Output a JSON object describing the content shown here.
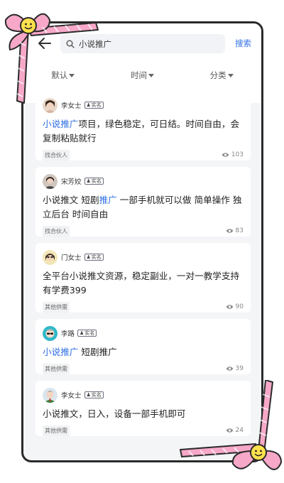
{
  "search": {
    "value": "小说推广",
    "button_label": "搜索"
  },
  "filters": [
    {
      "label": "默认"
    },
    {
      "label": "时间"
    },
    {
      "label": "分类"
    }
  ],
  "verify_label": "实名",
  "posts": [
    {
      "user": "李女士",
      "content": [
        {
          "text": "小说推广",
          "hl": true
        },
        {
          "text": "项目，绿色稳定，可日结。时间自由，会复制粘贴就行",
          "hl": false
        }
      ],
      "tag": "找合伙人",
      "views": "103"
    },
    {
      "user": "宋芳姣",
      "content": [
        {
          "text": "小说推文 短剧",
          "hl": false
        },
        {
          "text": "推广",
          "hl": true
        },
        {
          "text": " 一部手机就可以做 简单操作 独立后台 时间自由",
          "hl": false
        }
      ],
      "tag": "找合伙人",
      "views": "83"
    },
    {
      "user": "门女士",
      "content": [
        {
          "text": "全平台小说推文资源，稳定副业，一对一教学支持 有学费399",
          "hl": false
        }
      ],
      "tag": "其他供需",
      "views": "90"
    },
    {
      "user": "李路",
      "content": [
        {
          "text": "小说推广",
          "hl": true
        },
        {
          "text": " 短剧推广",
          "hl": false
        }
      ],
      "tag": "其他供需",
      "views": "39"
    },
    {
      "user": "李女士",
      "content": [
        {
          "text": "小说推文，日入，设备一部手机即可",
          "hl": false
        }
      ],
      "tag": "其他供需",
      "views": "24"
    }
  ],
  "colors": {
    "accent": "#2f6fe4",
    "ribbon_pink": "#f7a8c8",
    "background": "#f4f5f7"
  }
}
